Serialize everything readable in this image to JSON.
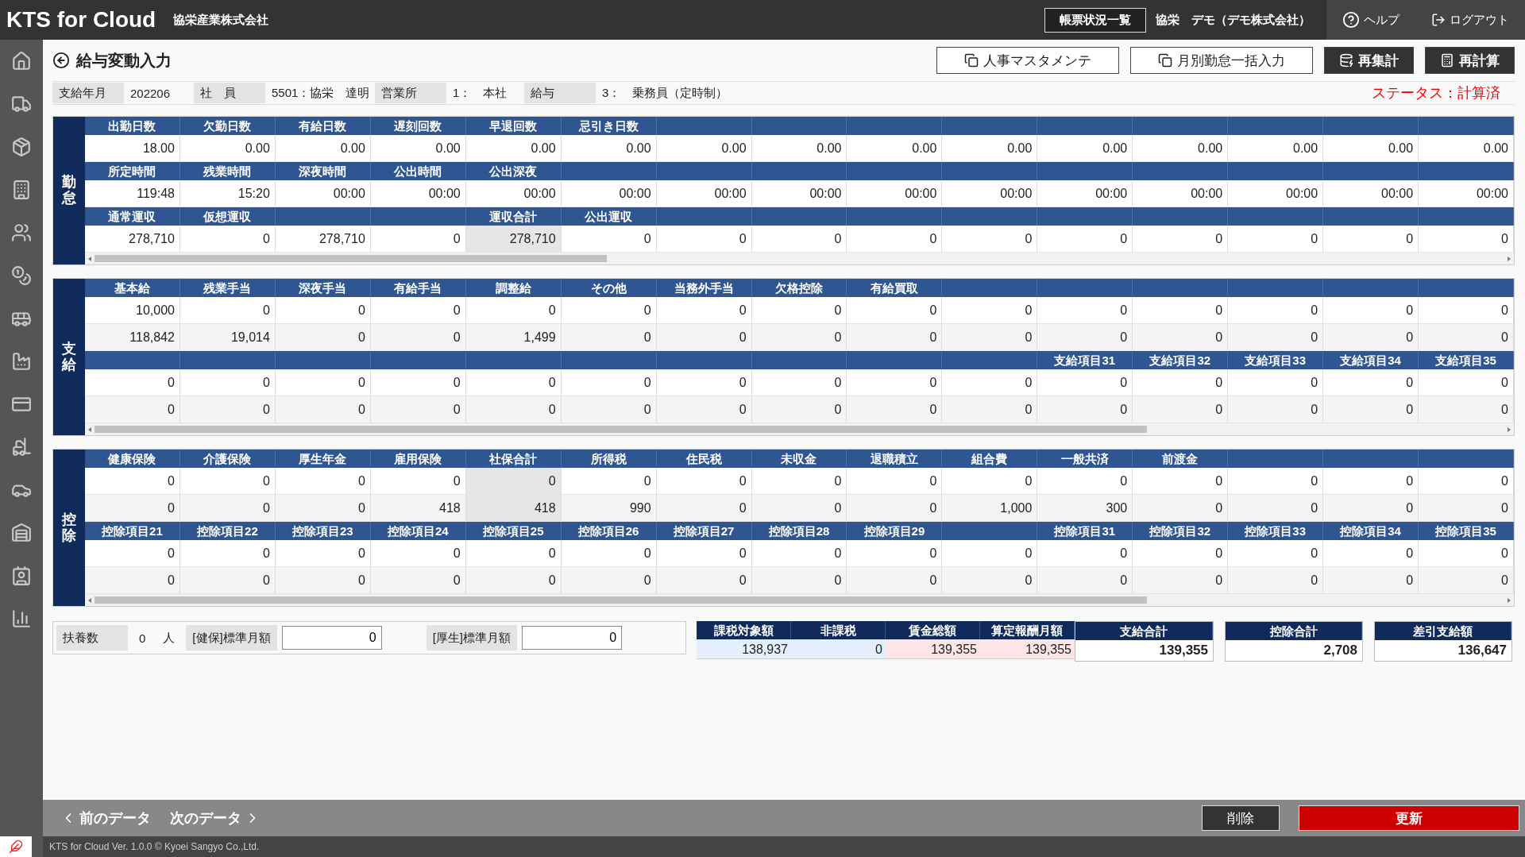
{
  "header": {
    "logo": "KTS for Cloud",
    "company": "協栄産業株式会社",
    "report_button": "帳票状況一覧",
    "user": "協栄　デモ（デモ株式会社）",
    "help": "ヘルプ",
    "logout": "ログアウト"
  },
  "page": {
    "title": "給与変動入力",
    "actions": [
      {
        "label": "人事マスタメンテ",
        "kind": "outline"
      },
      {
        "label": "月別勤怠一括入力",
        "kind": "outline"
      },
      {
        "label": "再集計",
        "kind": "dark"
      },
      {
        "label": "再計算",
        "kind": "dark"
      }
    ]
  },
  "info": {
    "fields": [
      {
        "label": "支給年月",
        "value": "202206"
      },
      {
        "label": "社　員",
        "value": "5501：協栄　達明"
      },
      {
        "label": "営業所",
        "value": "1：　本社"
      },
      {
        "label": "給与",
        "value": "3：　乗務員（定時制）"
      }
    ],
    "status": "ステータス：計算済"
  },
  "sections": [
    {
      "label": "勤怠",
      "blocks": [
        {
          "columns": [
            {
              "header": "出勤日数",
              "values": [
                "18.00"
              ]
            },
            {
              "header": "欠勤日数",
              "values": [
                "0.00"
              ]
            },
            {
              "header": "有給日数",
              "values": [
                "0.00"
              ]
            },
            {
              "header": "遅刻回数",
              "values": [
                "0.00"
              ]
            },
            {
              "header": "早退回数",
              "values": [
                "0.00"
              ]
            },
            {
              "header": "忌引き日数",
              "values": [
                "0.00"
              ]
            },
            {
              "values": [
                "0.00"
              ]
            },
            {
              "values": [
                "0.00"
              ]
            },
            {
              "values": [
                "0.00"
              ]
            },
            {
              "values": [
                "0.00"
              ]
            },
            {
              "values": [
                "0.00"
              ]
            },
            {
              "values": [
                "0.00"
              ]
            },
            {
              "values": [
                "0.00"
              ]
            },
            {
              "values": [
                "0.00"
              ]
            },
            {
              "values": [
                "0.00"
              ]
            }
          ]
        },
        {
          "columns": [
            {
              "header": "所定時間",
              "values": [
                "119:48"
              ]
            },
            {
              "header": "残業時間",
              "values": [
                "15:20"
              ]
            },
            {
              "header": "深夜時間",
              "values": [
                "00:00"
              ]
            },
            {
              "header": "公出時間",
              "values": [
                "00:00"
              ]
            },
            {
              "header": "公出深夜",
              "values": [
                "00:00"
              ]
            },
            {
              "values": [
                "00:00"
              ]
            },
            {
              "values": [
                "00:00"
              ]
            },
            {
              "values": [
                "00:00"
              ]
            },
            {
              "values": [
                "00:00"
              ]
            },
            {
              "values": [
                "00:00"
              ]
            },
            {
              "values": [
                "00:00"
              ]
            },
            {
              "values": [
                "00:00"
              ]
            },
            {
              "values": [
                "00:00"
              ]
            },
            {
              "values": [
                "00:00"
              ]
            },
            {
              "values": [
                "00:00"
              ]
            }
          ]
        },
        {
          "columns": [
            {
              "header": "通常運収",
              "values": [
                "278,710"
              ]
            },
            {
              "header": "仮想運収",
              "values": [
                "0"
              ]
            },
            {
              "values": [
                "278,710"
              ]
            },
            {
              "values": [
                "0"
              ]
            },
            {
              "header": "運収合計",
              "values": [
                "278,710"
              ],
              "readonly": true
            },
            {
              "header": "公出運収",
              "values": [
                "0"
              ]
            },
            {
              "values": [
                "0"
              ]
            },
            {
              "values": [
                "0"
              ]
            },
            {
              "values": [
                "0"
              ]
            },
            {
              "values": [
                "0"
              ]
            },
            {
              "values": [
                "0"
              ]
            },
            {
              "values": [
                "0"
              ]
            },
            {
              "values": [
                "0"
              ]
            },
            {
              "values": [
                "0"
              ]
            },
            {
              "values": [
                "0"
              ]
            }
          ]
        }
      ]
    },
    {
      "label": "支給",
      "blocks": [
        {
          "columns": [
            {
              "header": "基本給",
              "values": [
                "10,000",
                "118,842"
              ]
            },
            {
              "header": "残業手当",
              "values": [
                "0",
                "19,014"
              ]
            },
            {
              "header": "深夜手当",
              "values": [
                "0",
                "0"
              ]
            },
            {
              "header": "有給手当",
              "values": [
                "0",
                "0"
              ]
            },
            {
              "header": "調整給",
              "values": [
                "0",
                "1,499"
              ]
            },
            {
              "header": "その他",
              "values": [
                "0",
                "0"
              ]
            },
            {
              "header": "当務外手当",
              "values": [
                "0",
                "0"
              ]
            },
            {
              "header": "欠格控除",
              "values": [
                "0",
                "0"
              ]
            },
            {
              "header": "有給買取",
              "values": [
                "0",
                "0"
              ]
            },
            {
              "values": [
                "0",
                "0"
              ]
            },
            {
              "values": [
                "0",
                "0"
              ]
            },
            {
              "values": [
                "0",
                "0"
              ]
            },
            {
              "values": [
                "0",
                "0"
              ]
            },
            {
              "values": [
                "0",
                "0"
              ]
            },
            {
              "values": [
                "0",
                "0"
              ]
            }
          ]
        },
        {
          "columns": [
            {
              "values": [
                "0",
                "0"
              ]
            },
            {
              "values": [
                "0",
                "0"
              ]
            },
            {
              "values": [
                "0",
                "0"
              ]
            },
            {
              "values": [
                "0",
                "0"
              ]
            },
            {
              "values": [
                "0",
                "0"
              ]
            },
            {
              "values": [
                "0",
                "0"
              ]
            },
            {
              "values": [
                "0",
                "0"
              ]
            },
            {
              "values": [
                "0",
                "0"
              ]
            },
            {
              "values": [
                "0",
                "0"
              ]
            },
            {
              "values": [
                "0",
                "0"
              ]
            },
            {
              "header": "支給項目31",
              "values": [
                "0",
                "0"
              ]
            },
            {
              "header": "支給項目32",
              "values": [
                "0",
                "0"
              ]
            },
            {
              "header": "支給項目33",
              "values": [
                "0",
                "0"
              ]
            },
            {
              "header": "支給項目34",
              "values": [
                "0",
                "0"
              ]
            },
            {
              "header": "支給項目35",
              "values": [
                "0",
                "0"
              ]
            }
          ]
        }
      ]
    },
    {
      "label": "控除",
      "blocks": [
        {
          "columns": [
            {
              "header": "健康保険",
              "values": [
                "0",
                "0"
              ]
            },
            {
              "header": "介護保険",
              "values": [
                "0",
                "0"
              ]
            },
            {
              "header": "厚生年金",
              "values": [
                "0",
                "0"
              ]
            },
            {
              "header": "雇用保険",
              "values": [
                "0",
                "418"
              ]
            },
            {
              "header": "社保合計",
              "values": [
                "0",
                "418"
              ],
              "readonly": true
            },
            {
              "header": "所得税",
              "values": [
                "0",
                "990"
              ]
            },
            {
              "header": "住民税",
              "values": [
                "0",
                "0"
              ]
            },
            {
              "header": "未収金",
              "values": [
                "0",
                "0"
              ]
            },
            {
              "header": "退職積立",
              "values": [
                "0",
                "0"
              ]
            },
            {
              "header": "組合費",
              "values": [
                "0",
                "1,000"
              ]
            },
            {
              "header": "一般共済",
              "values": [
                "0",
                "300"
              ]
            },
            {
              "header": "前渡金",
              "values": [
                "0",
                "0"
              ]
            },
            {
              "values": [
                "0",
                "0"
              ]
            },
            {
              "values": [
                "0",
                "0"
              ]
            },
            {
              "values": [
                "0",
                "0"
              ]
            }
          ]
        },
        {
          "columns": [
            {
              "header": "控除項目21",
              "values": [
                "0",
                "0"
              ]
            },
            {
              "header": "控除項目22",
              "values": [
                "0",
                "0"
              ]
            },
            {
              "header": "控除項目23",
              "values": [
                "0",
                "0"
              ]
            },
            {
              "header": "控除項目24",
              "values": [
                "0",
                "0"
              ]
            },
            {
              "header": "控除項目25",
              "values": [
                "0",
                "0"
              ]
            },
            {
              "header": "控除項目26",
              "values": [
                "0",
                "0"
              ]
            },
            {
              "header": "控除項目27",
              "values": [
                "0",
                "0"
              ]
            },
            {
              "header": "控除項目28",
              "values": [
                "0",
                "0"
              ]
            },
            {
              "header": "控除項目29",
              "values": [
                "0",
                "0"
              ]
            },
            {
              "values": [
                "0",
                "0"
              ]
            },
            {
              "header": "控除項目31",
              "values": [
                "0",
                "0"
              ]
            },
            {
              "header": "控除項目32",
              "values": [
                "0",
                "0"
              ]
            },
            {
              "header": "控除項目33",
              "values": [
                "0",
                "0"
              ]
            },
            {
              "header": "控除項目34",
              "values": [
                "0",
                "0"
              ]
            },
            {
              "header": "控除項目35",
              "values": [
                "0",
                "0"
              ]
            }
          ]
        }
      ]
    }
  ],
  "dependents": {
    "label": "扶養数",
    "value": "0",
    "unit": "人"
  },
  "standard_amounts": [
    {
      "label": "[健保]標準月額",
      "value": "0"
    },
    {
      "label": "[厚生]標準月額",
      "value": "0"
    }
  ],
  "breakdown": [
    {
      "label": "課税対象額",
      "value": "138,937",
      "color": "#e4effc"
    },
    {
      "label": "非課税",
      "value": "0",
      "color": "#e4effc"
    },
    {
      "label": "賃金総額",
      "value": "139,355",
      "color": "#fde4e6"
    },
    {
      "label": "算定報酬月額",
      "value": "139,355",
      "color": "#fde4e6"
    }
  ],
  "totals": [
    {
      "label": "支給合計",
      "value": "139,355"
    },
    {
      "label": "控除合計",
      "value": "2,708"
    },
    {
      "label": "差引支給額",
      "value": "136,647"
    }
  ],
  "footer": {
    "prev": "前のデータ",
    "next": "次のデータ",
    "delete": "削除",
    "update": "更新",
    "version": "KTS for Cloud Ver. 1.0.0 © Kyoei Sangyo Co.,Ltd."
  }
}
